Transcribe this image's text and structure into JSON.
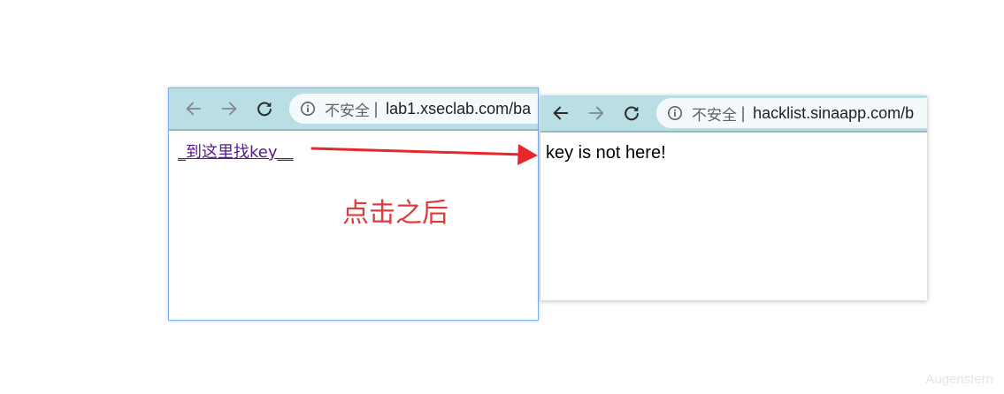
{
  "left_window": {
    "toolbar": {
      "back_icon": "arrow-left-icon",
      "forward_icon": "arrow-right-icon",
      "reload_icon": "reload-icon",
      "info_icon": "info-circle-icon",
      "security_label": "不安全",
      "separator": "|",
      "url": "lab1.xseclab.com/ba"
    },
    "page": {
      "link_text": "_到这里找key__"
    }
  },
  "right_window": {
    "toolbar": {
      "back_icon": "arrow-left-icon",
      "forward_icon": "arrow-right-icon",
      "reload_icon": "reload-icon",
      "info_icon": "info-circle-icon",
      "security_label": "不安全",
      "separator": "|",
      "url": "hacklist.sinaapp.com/b"
    },
    "page": {
      "body_text": "key is not here!"
    }
  },
  "annotation": {
    "text": "点击之后",
    "color": "#e03a3a"
  },
  "arrow": {
    "color": "#e8262b"
  },
  "watermark": {
    "text": "Augenstern"
  },
  "colors": {
    "toolbar_bg": "#b9dfe4",
    "omnibox_bg": "#f4fafb",
    "visited_link": "#551a8b"
  }
}
